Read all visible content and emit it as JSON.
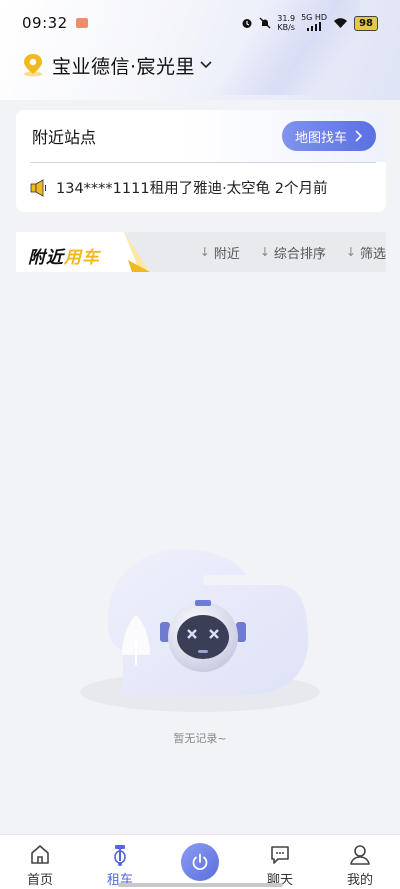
{
  "status_bar": {
    "time": "09:32",
    "net_speed_value": "31.9",
    "net_speed_unit": "KB/s",
    "network_label": "5G HD",
    "battery": "98"
  },
  "location": {
    "title": "宝业德信·宸光里"
  },
  "nearby_card": {
    "title": "附近站点",
    "map_button_label": "地图找车",
    "ticker_text": "134****1111租用了雅迪·太空龟 2个月前"
  },
  "vehicle_tabs": {
    "title_part1": "附近",
    "title_part2": "用车",
    "filters": [
      "附近",
      "综合排序",
      "筛选"
    ]
  },
  "empty_state": {
    "message": "暂无记录~"
  },
  "bottom_nav": {
    "items": [
      "首页",
      "租车",
      "聊天",
      "我的"
    ]
  },
  "colors": {
    "accent": "#5a6fe2",
    "highlight_yellow": "#f2b81f",
    "background": "#f2f3f7"
  }
}
